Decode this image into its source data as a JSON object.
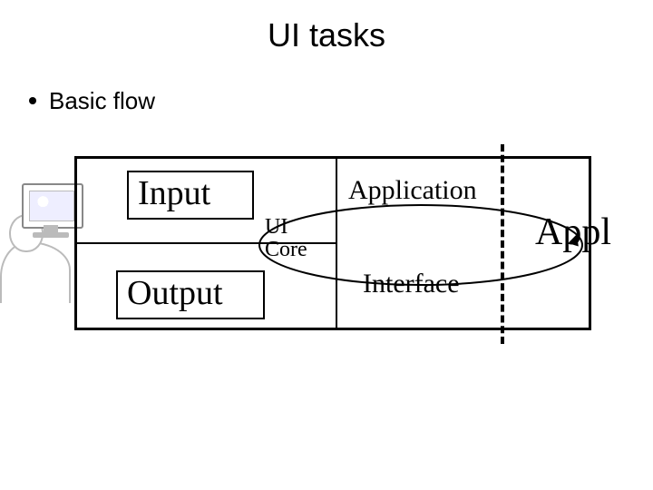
{
  "title": "UI tasks",
  "bullet": "Basic flow",
  "boxes": {
    "input": "Input",
    "output": "Output"
  },
  "labels": {
    "ui_core_line1": "UI",
    "ui_core_line2": "Core",
    "application": "Application",
    "interface": "Interface",
    "appl": "Appl"
  }
}
